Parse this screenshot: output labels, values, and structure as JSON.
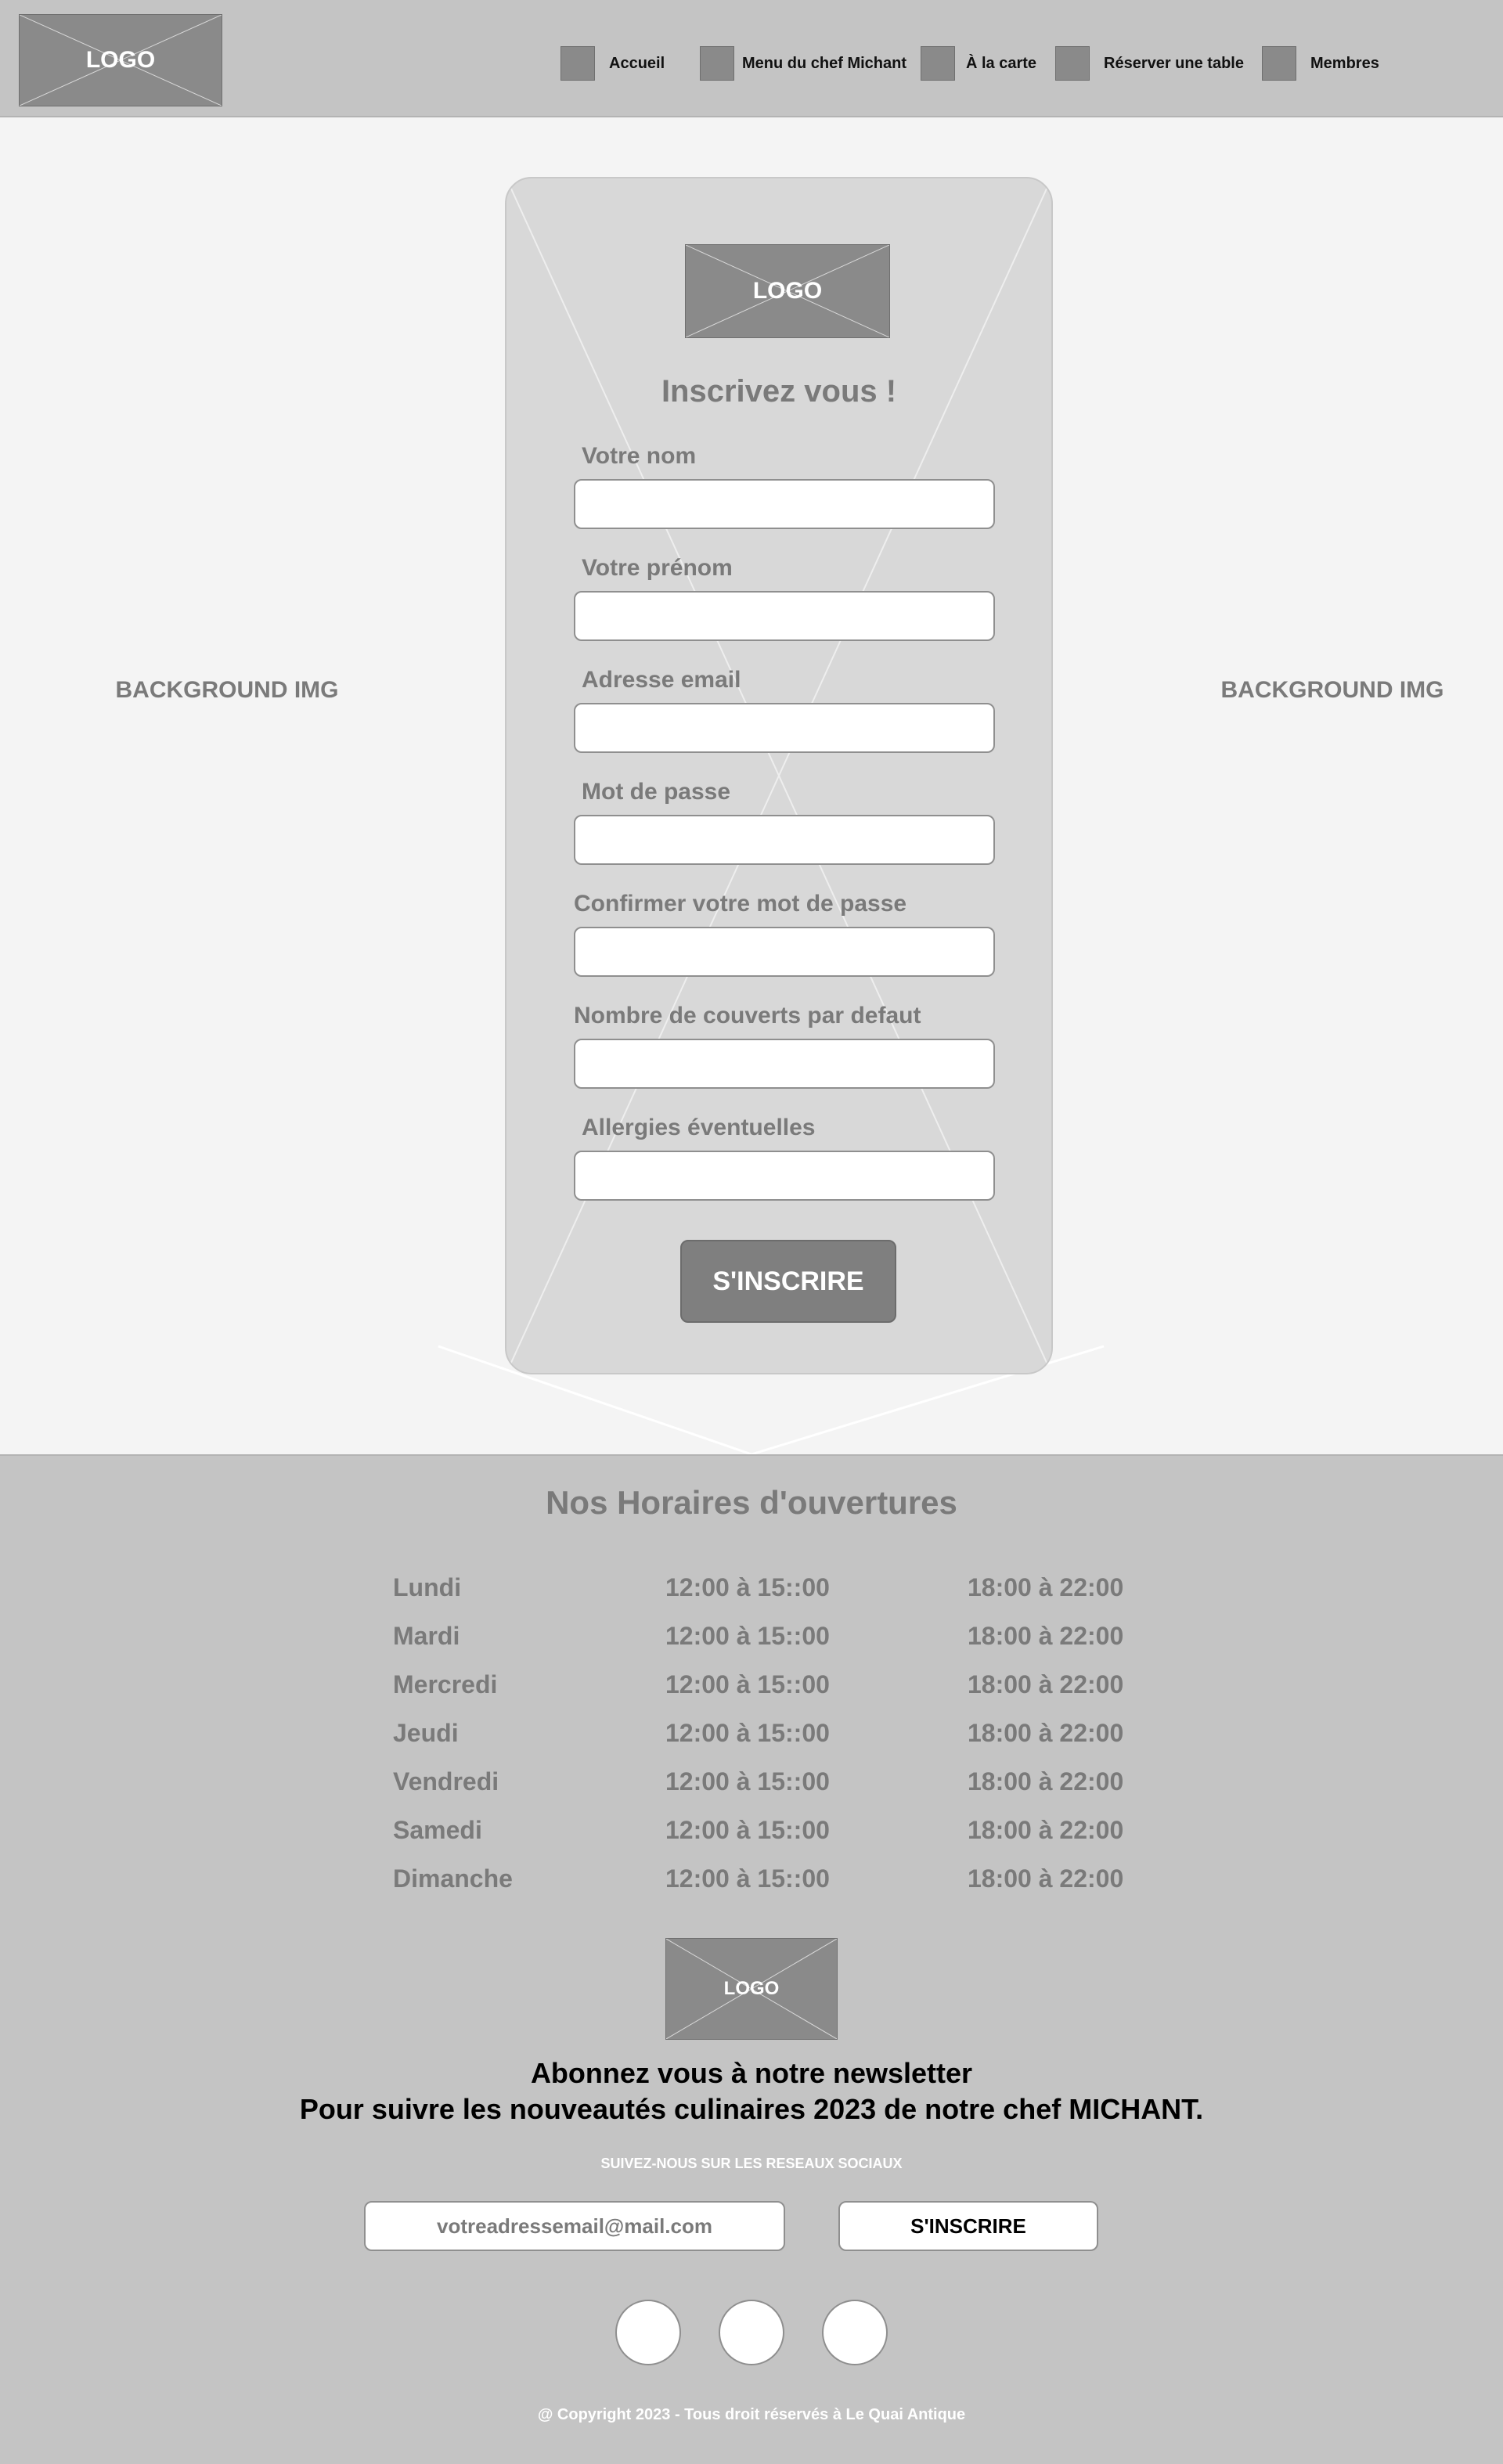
{
  "header": {
    "logo_text": "LOGO",
    "nav": [
      {
        "label": "Accueil"
      },
      {
        "label": "Menu du chef Michant"
      },
      {
        "label": "À la carte"
      },
      {
        "label": "Réserver une table"
      },
      {
        "label": "Membres"
      }
    ]
  },
  "hero": {
    "bg_left": "BACKGROUND IMG",
    "bg_right": "BACKGROUND IMG"
  },
  "form": {
    "logo_text": "LOGO",
    "title": "Inscrivez vous !",
    "fields": [
      {
        "label": "Votre nom",
        "value": ""
      },
      {
        "label": "Votre prénom",
        "value": ""
      },
      {
        "label": "Adresse email",
        "value": ""
      },
      {
        "label": "Mot de passe",
        "value": ""
      },
      {
        "label": "Confirmer votre mot de passe",
        "value": ""
      },
      {
        "label": "Nombre de couverts par defaut",
        "value": ""
      },
      {
        "label": "Allergies éventuelles",
        "value": ""
      }
    ],
    "submit_label": "S'INSCRIRE"
  },
  "footer": {
    "hours_title": "Nos Horaires d'ouvertures",
    "hours": [
      {
        "day": "Lundi",
        "lunch": "12:00 à 15::00",
        "dinner": "18:00 à 22:00"
      },
      {
        "day": "Mardi",
        "lunch": "12:00 à 15::00",
        "dinner": "18:00 à 22:00"
      },
      {
        "day": "Mercredi",
        "lunch": "12:00 à 15::00",
        "dinner": "18:00 à 22:00"
      },
      {
        "day": "Jeudi",
        "lunch": "12:00 à 15::00",
        "dinner": "18:00 à 22:00"
      },
      {
        "day": "Vendredi",
        "lunch": "12:00 à 15::00",
        "dinner": "18:00 à 22:00"
      },
      {
        "day": "Samedi",
        "lunch": "12:00 à 15::00",
        "dinner": "18:00 à 22:00"
      },
      {
        "day": "Dimanche",
        "lunch": "12:00 à 15::00",
        "dinner": "18:00 à 22:00"
      }
    ],
    "logo_text": "LOGO",
    "newsletter_line1": "Abonnez vous à notre newsletter",
    "newsletter_line2": "Pour suivre les nouveautés culinaires 2023 de notre chef MICHANT.",
    "social_caption": "SUIVEZ-NOUS SUR LES RESEAUX SOCIAUX",
    "email_placeholder": "votreadressemail@mail.com",
    "subscribe_label": "S'INSCRIRE",
    "social_icons": [
      "social-icon-1",
      "social-icon-2",
      "social-icon-3"
    ],
    "copyright": "@ Copyright 2023 - Tous droit réservés à  Le Quai Antique"
  },
  "colors": {
    "header_bg": "#c4c4c4",
    "page_bg": "#f4f4f4",
    "card_bg": "#d8d8d8",
    "placeholder_grey": "#8a8a8a",
    "muted_text": "#7a7a7a"
  }
}
